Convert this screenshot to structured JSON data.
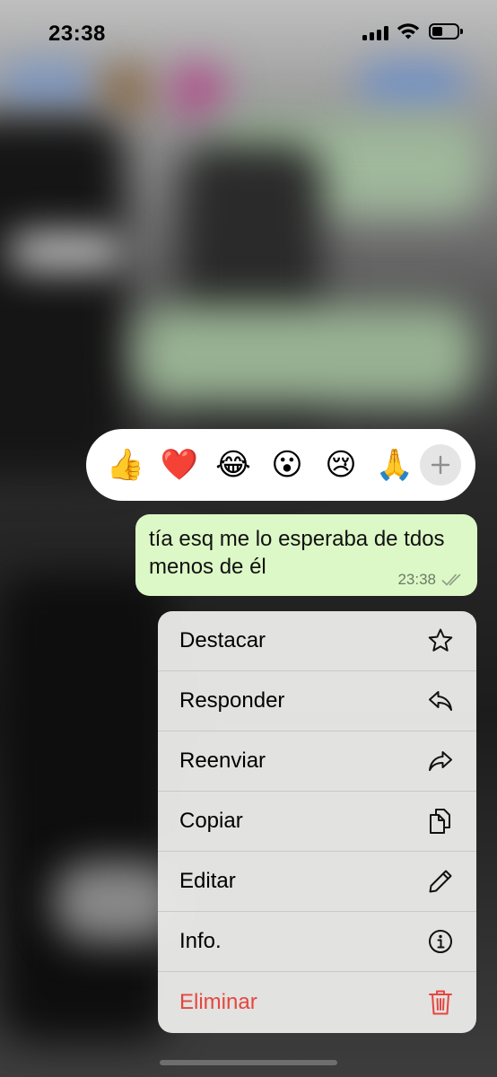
{
  "status_bar": {
    "time": "23:38"
  },
  "reactions": [
    {
      "emoji": "👍",
      "name": "thumbs-up"
    },
    {
      "emoji": "❤️",
      "name": "red-heart"
    },
    {
      "emoji": "😂",
      "name": "tears-of-joy"
    },
    {
      "emoji": "😮",
      "name": "surprised"
    },
    {
      "emoji": "😢",
      "name": "crying"
    },
    {
      "emoji": "🙏",
      "name": "folded-hands"
    }
  ],
  "message": {
    "text": "tía esq me lo esperaba de tdos menos de él",
    "time": "23:38",
    "status_icon": "double-check-icon"
  },
  "menu": {
    "items": [
      {
        "label": "Destacar",
        "icon": "star-icon"
      },
      {
        "label": "Responder",
        "icon": "reply-icon"
      },
      {
        "label": "Reenviar",
        "icon": "forward-icon"
      },
      {
        "label": "Copiar",
        "icon": "copy-icon"
      },
      {
        "label": "Editar",
        "icon": "pencil-icon"
      },
      {
        "label": "Info.",
        "icon": "info-icon"
      },
      {
        "label": "Eliminar",
        "icon": "trash-icon"
      }
    ],
    "danger_color": "#e5463f"
  },
  "colors": {
    "bubble": "#dcf8c6",
    "menu_bg": "#e8e8e6"
  }
}
